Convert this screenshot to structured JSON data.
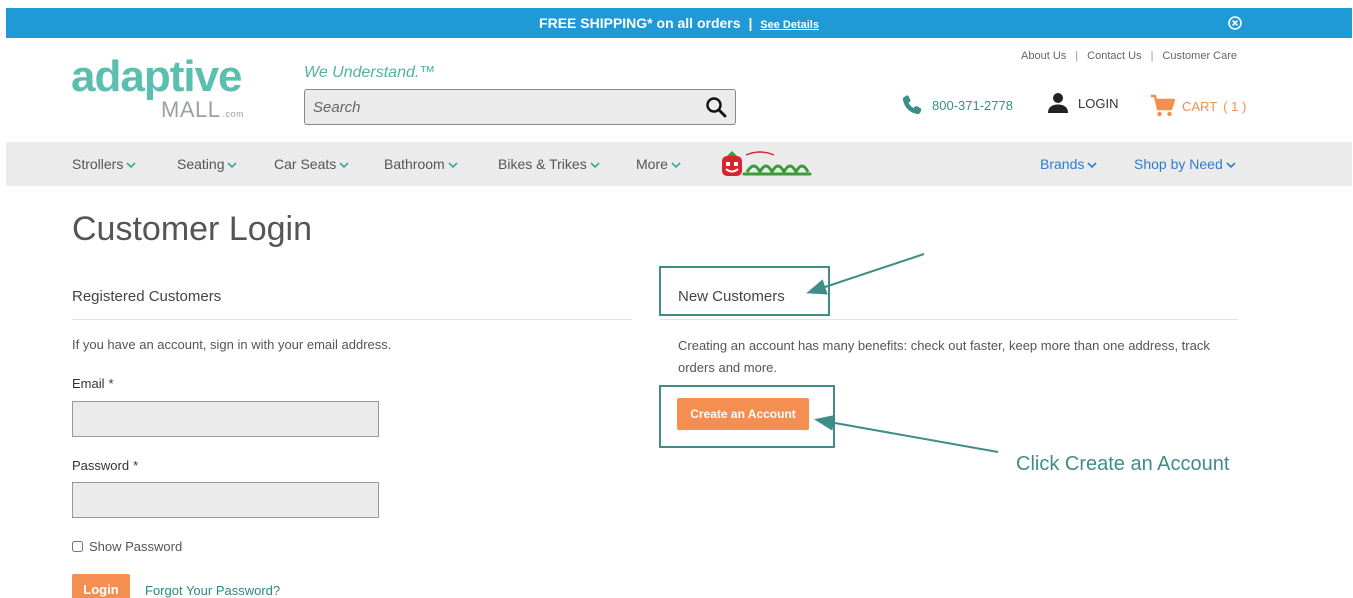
{
  "promo": {
    "text": "FREE SHIPPING* on all orders",
    "separator": "|",
    "details_link": "See Details"
  },
  "header": {
    "logo_top": "adaptive",
    "logo_bottom": "MALL",
    "logo_suffix": ".com",
    "tagline": "We Understand.™",
    "search_placeholder": "Search",
    "top_links": [
      "About Us",
      "Contact Us",
      "Customer Care"
    ],
    "phone": "800-371-2778",
    "login_label": "LOGIN",
    "cart_label": "CART",
    "cart_count": "( 1 )",
    "brand_color": "#5bbfb0",
    "accent_color": "#f58f51",
    "promo_color": "#1f9ad6"
  },
  "nav": {
    "items": [
      "Strollers",
      "Seating",
      "Car Seats",
      "Bathroom",
      "Bikes & Trikes",
      "More"
    ],
    "right_items": [
      "Brands",
      "Shop by Need"
    ]
  },
  "page": {
    "title": "Customer Login",
    "registered": {
      "heading": "Registered Customers",
      "note": "If you have an account, sign in with your email address.",
      "email_label": "Email",
      "password_label": "Password",
      "required_mark": "*",
      "show_password": "Show Password",
      "login_button": "Login",
      "forgot_link": "Forgot Your Password?"
    },
    "new_customers": {
      "heading": "New Customers",
      "note": "Creating an account has many benefits: check out faster, keep more than one address, track orders and more.",
      "create_button": "Create an Account"
    }
  },
  "annotation": {
    "text": "Click Create an Account",
    "color": "#3f8d86"
  }
}
